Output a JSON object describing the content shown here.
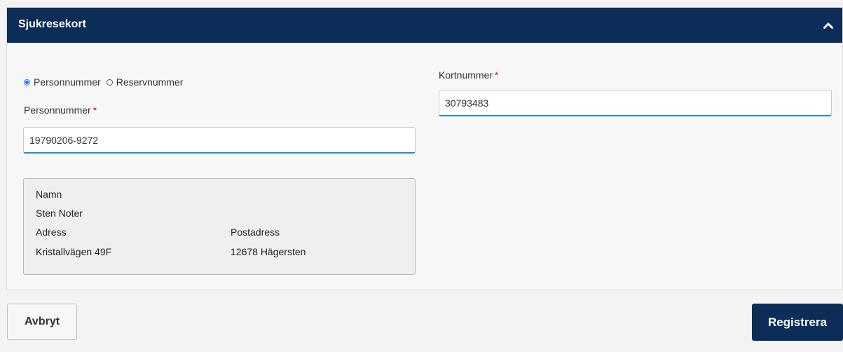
{
  "panel": {
    "title": "Sjukresekort",
    "collapse_icon": "chevron-up-icon"
  },
  "id_type": {
    "options": [
      "Personnummer",
      "Reservnummer"
    ],
    "selected": "Personnummer"
  },
  "personnummer": {
    "label": "Personnummer",
    "required_mark": "*",
    "value": "19790206-9272"
  },
  "kortnummer": {
    "label": "Kortnummer",
    "required_mark": "*",
    "value": "30793483"
  },
  "person_info": {
    "name_label": "Namn",
    "name_value": "Sten Noter",
    "address_label": "Adress",
    "address_value": "Kristallvägen 49F",
    "postal_label": "Postadress",
    "postal_value": "12678 Hägersten"
  },
  "actions": {
    "cancel_label": "Avbryt",
    "register_label": "Registrera"
  },
  "colors": {
    "header_bg": "#0b2d57",
    "required": "#c8102e",
    "input_focus": "#2d89c8"
  }
}
